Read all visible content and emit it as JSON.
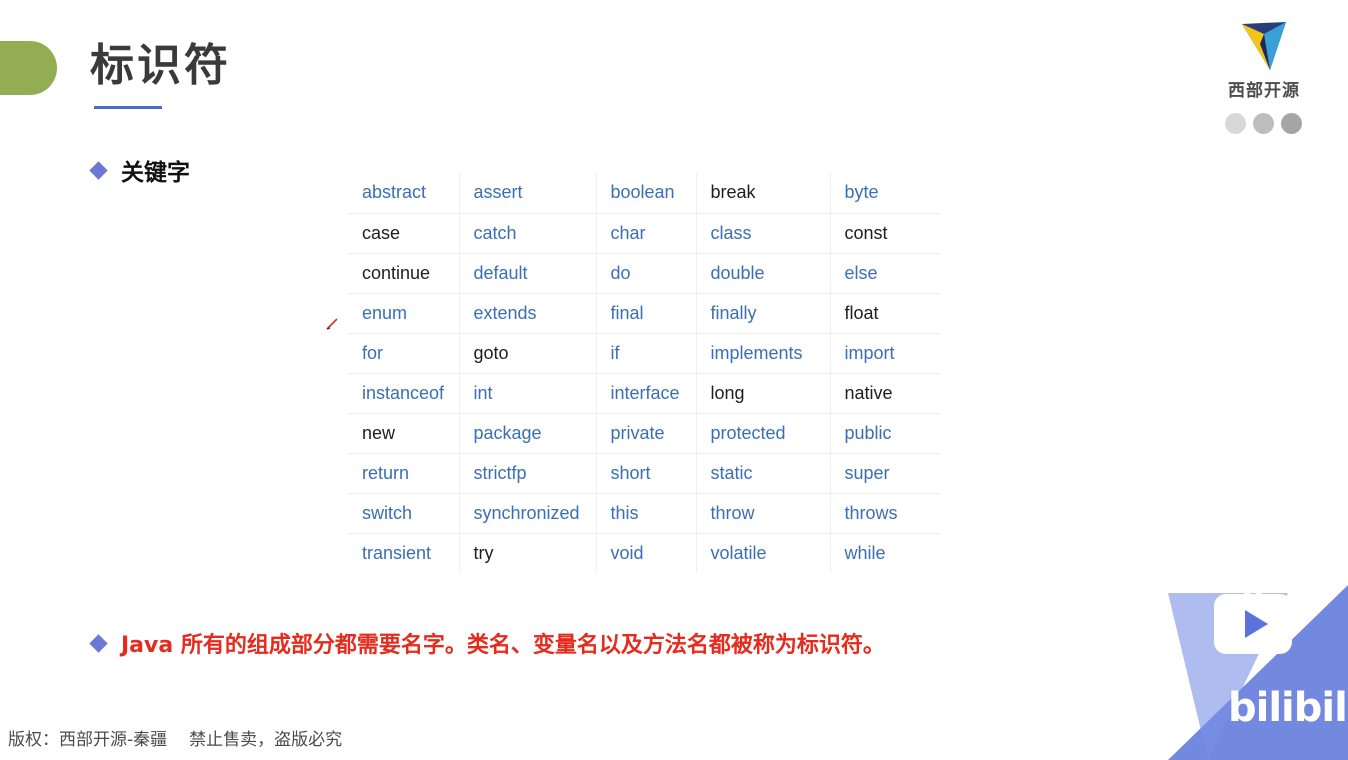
{
  "slide": {
    "title": "标识符",
    "logo_text": "西部开源",
    "bullet_keywords": "关键字",
    "bullet_note": "Java 所有的组成部分都需要名字。类名、变量名以及方法名都被称为标识符。",
    "copyright": "版权：西部开源-秦疆",
    "copyright_notice": "禁止售卖，盗版必究"
  },
  "keywords": {
    "rows": [
      [
        [
          "abstract",
          "blue"
        ],
        [
          "assert",
          "blue"
        ],
        [
          "boolean",
          "blue"
        ],
        [
          "break",
          "black"
        ],
        [
          "byte",
          "blue"
        ]
      ],
      [
        [
          "case",
          "black"
        ],
        [
          "catch",
          "blue"
        ],
        [
          "char",
          "blue"
        ],
        [
          "class",
          "blue"
        ],
        [
          "const",
          "black"
        ]
      ],
      [
        [
          "continue",
          "black"
        ],
        [
          "default",
          "blue"
        ],
        [
          "do",
          "blue"
        ],
        [
          "double",
          "blue"
        ],
        [
          "else",
          "blue"
        ]
      ],
      [
        [
          "enum",
          "blue"
        ],
        [
          "extends",
          "blue"
        ],
        [
          "final",
          "blue"
        ],
        [
          "finally",
          "blue"
        ],
        [
          "float",
          "black"
        ]
      ],
      [
        [
          "for",
          "blue"
        ],
        [
          "goto",
          "black"
        ],
        [
          "if",
          "blue"
        ],
        [
          "implements",
          "blue"
        ],
        [
          "import",
          "blue"
        ]
      ],
      [
        [
          "instanceof",
          "blue"
        ],
        [
          "int",
          "blue"
        ],
        [
          "interface",
          "blue"
        ],
        [
          "long",
          "black"
        ],
        [
          "native",
          "black"
        ]
      ],
      [
        [
          "new",
          "black"
        ],
        [
          "package",
          "blue"
        ],
        [
          "private",
          "blue"
        ],
        [
          "protected",
          "blue"
        ],
        [
          "public",
          "blue"
        ]
      ],
      [
        [
          "return",
          "blue"
        ],
        [
          "strictfp",
          "blue"
        ],
        [
          "short",
          "blue"
        ],
        [
          "static",
          "blue"
        ],
        [
          "super",
          "blue"
        ]
      ],
      [
        [
          "switch",
          "blue"
        ],
        [
          "synchronized",
          "blue"
        ],
        [
          "this",
          "blue"
        ],
        [
          "throw",
          "blue"
        ],
        [
          "throws",
          "blue"
        ]
      ],
      [
        [
          "transient",
          "blue"
        ],
        [
          "try",
          "black"
        ],
        [
          "void",
          "blue"
        ],
        [
          "volatile",
          "blue"
        ],
        [
          "while",
          "blue"
        ]
      ]
    ]
  },
  "colors": {
    "accent_green": "#93ae52",
    "title_underline": "#4a6bc7",
    "bullet_diamond": "#6b78d8",
    "keyword_blue": "#3a6fb5",
    "note_red": "#e62b1e",
    "watermark_blue": "#5b73d9"
  },
  "watermark": {
    "brand": "bilibili",
    "user": "秦疆"
  },
  "icons": {
    "logo": "v-triangle-logo-icon",
    "pen_cursor": "pen-cursor-icon",
    "watermark_tv": "bilibili-tv-icon"
  }
}
